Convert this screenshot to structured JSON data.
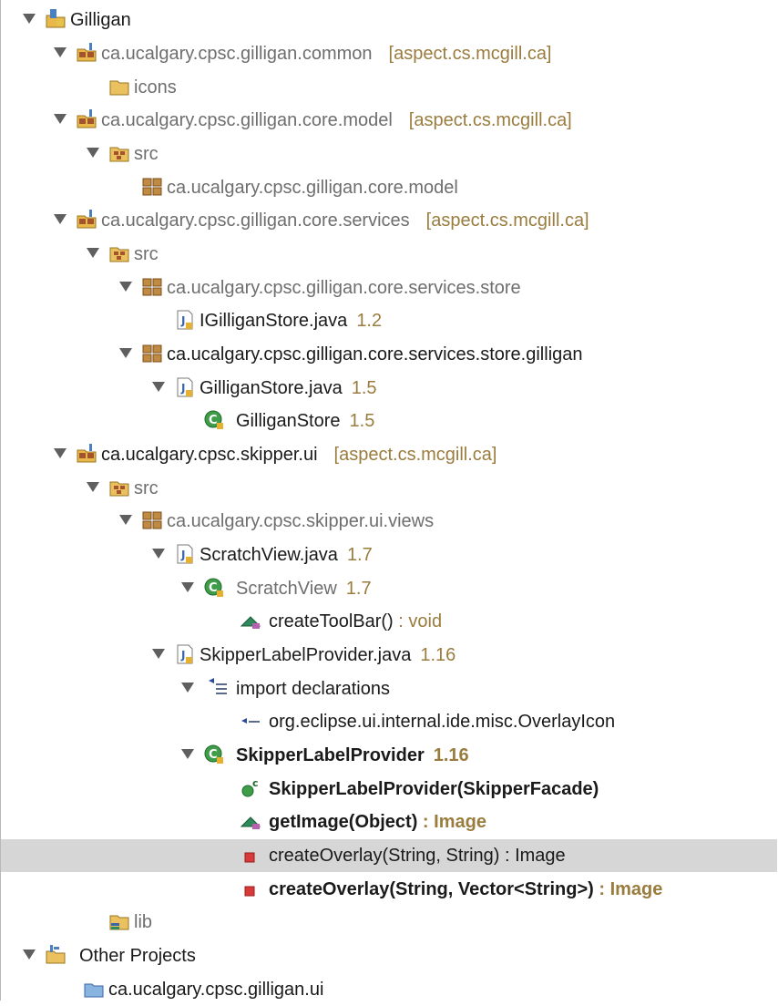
{
  "tree": {
    "nodes": [
      {
        "name": "project-gilligan",
        "icon": "java-project-icon",
        "label": "Gilligan",
        "suffix": "",
        "tail": "",
        "selected": false
      },
      {
        "name": "project-common",
        "icon": "shared-project-icon",
        "label": "ca.ucalgary.cpsc.gilligan.common",
        "suffix": "[aspect.cs.mcgill.ca]",
        "tail": "",
        "selected": false
      },
      {
        "name": "folder-icons",
        "icon": "folder-icon",
        "label": "icons",
        "suffix": "",
        "tail": "",
        "selected": false
      },
      {
        "name": "project-core-model",
        "icon": "shared-project-icon",
        "label": "ca.ucalgary.cpsc.gilligan.core.model",
        "suffix": "[aspect.cs.mcgill.ca]",
        "tail": "",
        "selected": false
      },
      {
        "name": "src-core-model",
        "icon": "source-folder-icon",
        "label": "src",
        "suffix": "",
        "tail": "",
        "selected": false
      },
      {
        "name": "package-core-model",
        "icon": "package-icon",
        "label": "ca.ucalgary.cpsc.gilligan.core.model",
        "suffix": "",
        "tail": "",
        "selected": false
      },
      {
        "name": "project-core-services",
        "icon": "shared-project-icon",
        "label": "ca.ucalgary.cpsc.gilligan.core.services",
        "suffix": "[aspect.cs.mcgill.ca]",
        "tail": "",
        "selected": false
      },
      {
        "name": "src-core-services",
        "icon": "source-folder-icon",
        "label": "src",
        "suffix": "",
        "tail": "",
        "selected": false
      },
      {
        "name": "package-services-store",
        "icon": "package-icon",
        "label": "ca.ucalgary.cpsc.gilligan.core.services.store",
        "suffix": "",
        "tail": "",
        "selected": false
      },
      {
        "name": "file-igilliganstore",
        "icon": "java-file-icon",
        "label": "IGilliganStore.java",
        "suffix": "1.2",
        "tail": "",
        "selected": false
      },
      {
        "name": "package-store-gilligan",
        "icon": "package-icon",
        "label": "ca.ucalgary.cpsc.gilligan.core.services.store.gilligan",
        "suffix": "",
        "tail": "",
        "selected": false
      },
      {
        "name": "file-gilliganstore",
        "icon": "java-file-icon",
        "label": "GilliganStore.java",
        "suffix": "1.5",
        "tail": "",
        "selected": false
      },
      {
        "name": "class-gilliganstore",
        "icon": "class-icon",
        "label": "GilliganStore",
        "suffix": "1.5",
        "tail": "",
        "selected": false
      },
      {
        "name": "project-skipper-ui",
        "icon": "shared-project-icon",
        "label": "ca.ucalgary.cpsc.skipper.ui",
        "suffix": "[aspect.cs.mcgill.ca]",
        "tail": "",
        "selected": false
      },
      {
        "name": "src-skipper-ui",
        "icon": "source-folder-icon",
        "label": "src",
        "suffix": "",
        "tail": "",
        "selected": false
      },
      {
        "name": "package-skipper-views",
        "icon": "package-icon",
        "label": "ca.ucalgary.cpsc.skipper.ui.views",
        "suffix": "",
        "tail": "",
        "selected": false
      },
      {
        "name": "file-scratchview",
        "icon": "java-file-icon",
        "label": "ScratchView.java",
        "suffix": "1.7",
        "tail": "",
        "selected": false
      },
      {
        "name": "class-scratchview",
        "icon": "class-icon",
        "label": "ScratchView",
        "suffix": "1.7",
        "tail": "",
        "selected": false
      },
      {
        "name": "method-createtoolbar",
        "icon": "protected-method-icon",
        "label": "createToolBar()",
        "suffix": "",
        "tail": " : void",
        "selected": false
      },
      {
        "name": "file-skipperlabelprovider",
        "icon": "java-file-icon",
        "label": "SkipperLabelProvider.java",
        "suffix": "1.16",
        "tail": "",
        "selected": false
      },
      {
        "name": "import-declarations",
        "icon": "imports-icon",
        "label": "import declarations",
        "suffix": "",
        "tail": "",
        "selected": false
      },
      {
        "name": "import-overlayicon",
        "icon": "import-icon",
        "label": "org.eclipse.ui.internal.ide.misc.OverlayIcon",
        "suffix": "",
        "tail": "",
        "selected": false
      },
      {
        "name": "class-skipperlabelprovider",
        "icon": "class-icon",
        "label": "SkipperLabelProvider",
        "suffix": "1.16",
        "tail": "",
        "selected": false
      },
      {
        "name": "constructor-skipperlabelprovider",
        "icon": "constructor-icon",
        "label": "SkipperLabelProvider(SkipperFacade)",
        "suffix": "",
        "tail": "",
        "selected": false
      },
      {
        "name": "method-getimage",
        "icon": "protected-method-icon",
        "label": "getImage(Object)",
        "suffix": "",
        "tail": " : Image",
        "selected": false
      },
      {
        "name": "method-createoverlay-string",
        "icon": "private-method-icon",
        "label": "createOverlay(String, String)",
        "suffix": "",
        "tail": " : Image",
        "selected": true
      },
      {
        "name": "method-createoverlay-vector",
        "icon": "private-method-icon",
        "label": "createOverlay(String, Vector<String>)",
        "suffix": "",
        "tail": " : Image",
        "selected": false
      },
      {
        "name": "folder-lib",
        "icon": "library-folder-icon",
        "label": "lib",
        "suffix": "",
        "tail": "",
        "selected": false
      },
      {
        "name": "group-other-projects",
        "icon": "working-set-icon",
        "label": "Other Projects",
        "suffix": "",
        "tail": "",
        "selected": false
      },
      {
        "name": "project-gilligan-ui",
        "icon": "closed-project-icon",
        "label": "ca.ucalgary.cpsc.gilligan.ui",
        "suffix": "",
        "tail": "",
        "selected": false
      }
    ]
  },
  "colors": {
    "selection": "#d6d6d6",
    "decoration": "#9a7c3e",
    "dim_text": "#6e6e6e",
    "text": "#1a1a1a"
  }
}
